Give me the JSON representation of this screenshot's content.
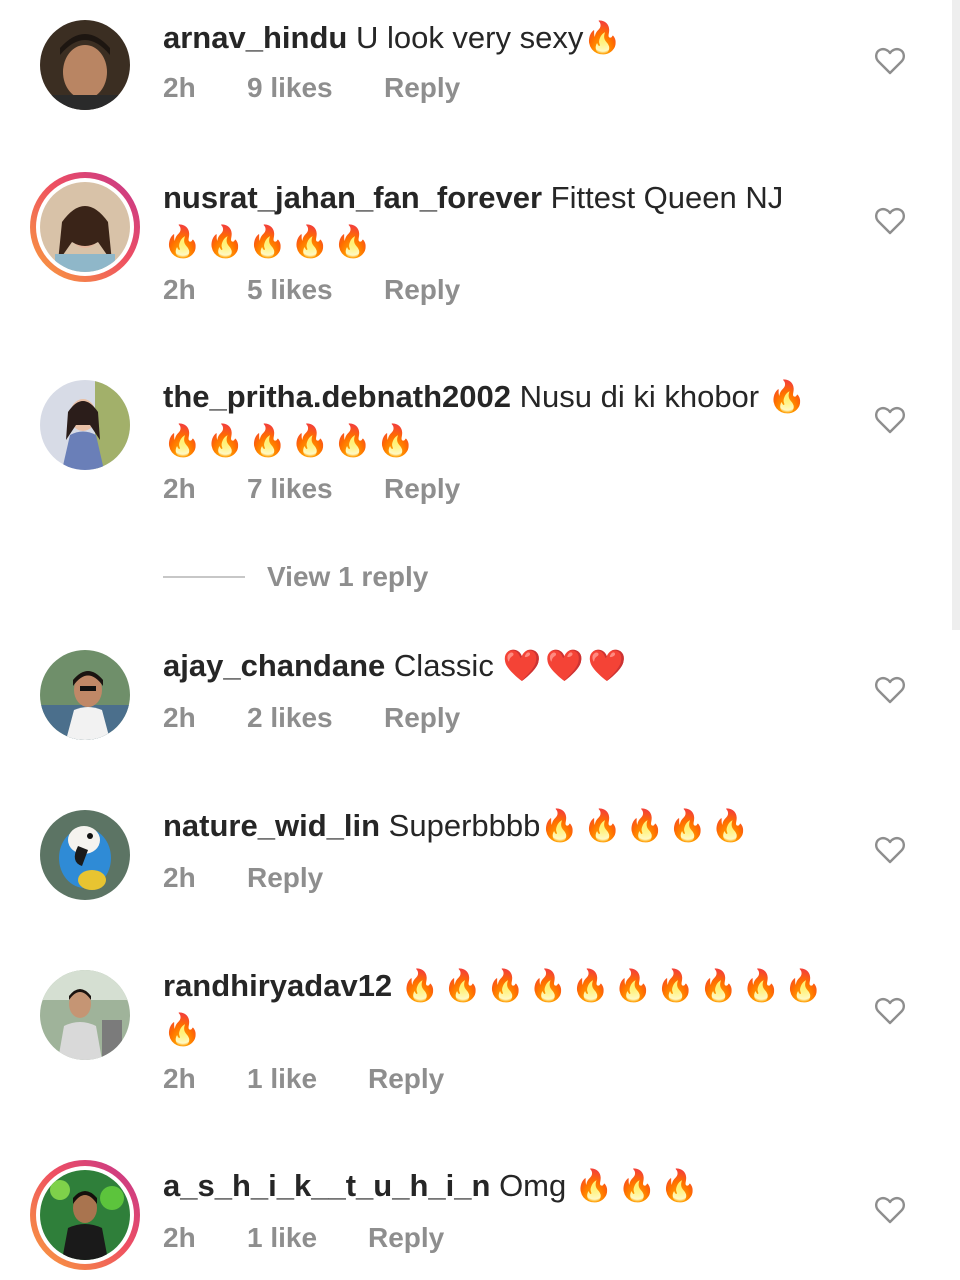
{
  "comments": [
    {
      "username": "arnav_hindu",
      "text": "U look very sexy",
      "emoji": "🔥",
      "time": "2h",
      "likes": "9 likes",
      "reply": "Reply",
      "avatar": "avatar-photo",
      "story_ring": false
    },
    {
      "username": "nusrat_jahan_fan_forever",
      "text": "Fittest Queen NJ",
      "emoji": "🔥🔥🔥🔥🔥",
      "time": "2h",
      "likes": "5 likes",
      "reply": "Reply",
      "avatar": "avatar-photo",
      "story_ring": true
    },
    {
      "username": "the_pritha.debnath2002",
      "text": "Nusu di ki khobor",
      "emoji": "🔥🔥🔥🔥🔥🔥🔥",
      "time": "2h",
      "likes": "7 likes",
      "reply": "Reply",
      "avatar": "avatar-photo",
      "story_ring": false,
      "view_replies": "View 1 reply"
    },
    {
      "username": "ajay_chandane",
      "text": "Classic",
      "emoji": "❤️❤️❤️",
      "time": "2h",
      "likes": "2 likes",
      "reply": "Reply",
      "avatar": "avatar-photo",
      "story_ring": false
    },
    {
      "username": "nature_wid_lin",
      "text": "Superbbbb",
      "emoji": "🔥🔥🔥🔥🔥",
      "time": "2h",
      "likes": "",
      "reply": "Reply",
      "avatar": "avatar-photo",
      "story_ring": false
    },
    {
      "username": "randhiryadav12",
      "text": "",
      "emoji": "🔥🔥🔥🔥🔥🔥🔥🔥🔥🔥 🔥",
      "time": "2h",
      "likes": "1 like",
      "reply": "Reply",
      "avatar": "avatar-photo",
      "story_ring": false
    },
    {
      "username": "a_s_h_i_k__t_u_h_i_n",
      "text": "Omg",
      "emoji": "🔥🔥🔥",
      "time": "2h",
      "likes": "1 like",
      "reply": "Reply",
      "avatar": "avatar-photo",
      "story_ring": true
    }
  ],
  "icons": {
    "like": "heart-outline-icon"
  },
  "colors": {
    "text_primary": "#262626",
    "text_secondary": "#8e8e8e",
    "story_ring_start": "#f9a23b",
    "story_ring_end": "#c1358f"
  }
}
